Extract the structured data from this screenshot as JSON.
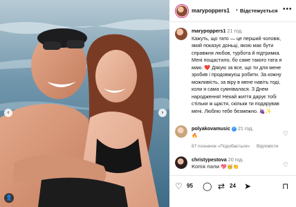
{
  "post": {
    "username": "marypoppers1",
    "follow_label": "Відстежується",
    "more_icon": "more-dots-icon"
  },
  "caption": {
    "username": "marypoppers1",
    "time": "21 год.",
    "text": "Кажуть, що тато — це перший чоловік, який показує доньці, якою має бути справжня любов, турбота й підтримка. Мені пощастило, бо саме такого тата я маю. ❤️ Дякую за все, що ти для мене зробив і продовжуєш робити. За кожну можливість, за віру в мене навіть тоді, коли я сама сумнівалася. З Днем народження! Нехай життя дарує тобі стільки ж щастя, скільки ти подарував мені. Люблю тебе безмежно. 🍇✨"
  },
  "comments": [
    {
      "username": "polyakovamusic",
      "time": "21 год.",
      "text": "🔥",
      "likes": "87 позначок «Подобається»",
      "reply": "Відповісти",
      "verified": true
    },
    {
      "username": "christypestova",
      "time": "20 год.",
      "text": "Копія папи 💖🥳👏",
      "verified": false
    }
  ],
  "actions": {
    "like_count": "95",
    "repost_count": "24"
  },
  "colors": {
    "accent_ring": "#d62976",
    "verified": "#3897f0",
    "heart": "#e0245e"
  }
}
